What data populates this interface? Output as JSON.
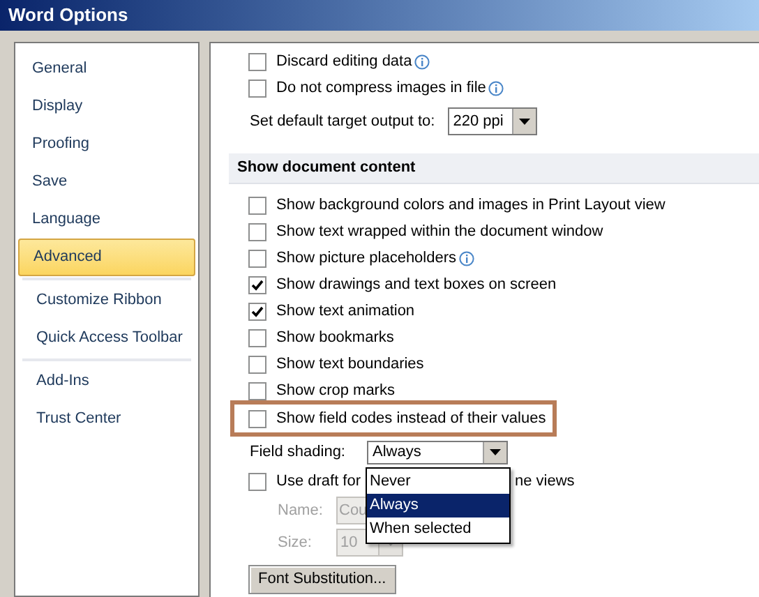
{
  "window": {
    "title": "Word Options"
  },
  "sidebar": {
    "groups": [
      {
        "items": [
          {
            "label": "General",
            "selected": false
          },
          {
            "label": "Display",
            "selected": false
          },
          {
            "label": "Proofing",
            "selected": false
          },
          {
            "label": "Save",
            "selected": false
          },
          {
            "label": "Language",
            "selected": false
          },
          {
            "label": "Advanced",
            "selected": true
          }
        ]
      },
      {
        "items": [
          {
            "label": "Customize Ribbon",
            "selected": false
          },
          {
            "label": "Quick Access Toolbar",
            "selected": false
          }
        ]
      },
      {
        "items": [
          {
            "label": "Add-Ins",
            "selected": false
          },
          {
            "label": "Trust Center",
            "selected": false
          }
        ]
      }
    ]
  },
  "top_rows": [
    {
      "kind": "checkbox",
      "label": "Discard editing data",
      "checked": false,
      "info": true
    },
    {
      "kind": "checkbox",
      "label": "Do not compress images in file",
      "checked": false,
      "info": true
    },
    {
      "kind": "select",
      "label": "Set default target output to:",
      "value": "220 ppi"
    }
  ],
  "section": {
    "title": "Show document content",
    "rows": [
      {
        "label": "Show background colors and images in Print Layout view",
        "checked": false,
        "info": false,
        "highlighted": false
      },
      {
        "label": "Show text wrapped within the document window",
        "checked": false,
        "info": false,
        "highlighted": false
      },
      {
        "label": "Show picture placeholders",
        "checked": false,
        "info": true,
        "highlighted": false
      },
      {
        "label": "Show drawings and text boxes on screen",
        "checked": true,
        "info": false,
        "highlighted": false
      },
      {
        "label": "Show text animation",
        "checked": true,
        "info": false,
        "highlighted": false
      },
      {
        "label": "Show bookmarks",
        "checked": false,
        "info": false,
        "highlighted": false
      },
      {
        "label": "Show text boundaries",
        "checked": false,
        "info": false,
        "highlighted": false
      },
      {
        "label": "Show crop marks",
        "checked": false,
        "info": false,
        "highlighted": false
      },
      {
        "label": "Show field codes instead of their values",
        "checked": false,
        "info": false,
        "highlighted": true
      }
    ]
  },
  "field_shading": {
    "label": "Field shading:",
    "value": "Always",
    "expanded": true,
    "options": [
      {
        "label": "Never",
        "selected": false
      },
      {
        "label": "Always",
        "selected": true
      },
      {
        "label": "When selected",
        "selected": false
      }
    ]
  },
  "draft_font": {
    "checked": false,
    "label_start": "Use draft for",
    "label_end": "ne views",
    "disabled": true,
    "name_label": "Name:",
    "name_value": "Cou",
    "size_label": "Size:",
    "size_value": "10"
  },
  "button": "Font Substitution..."
}
